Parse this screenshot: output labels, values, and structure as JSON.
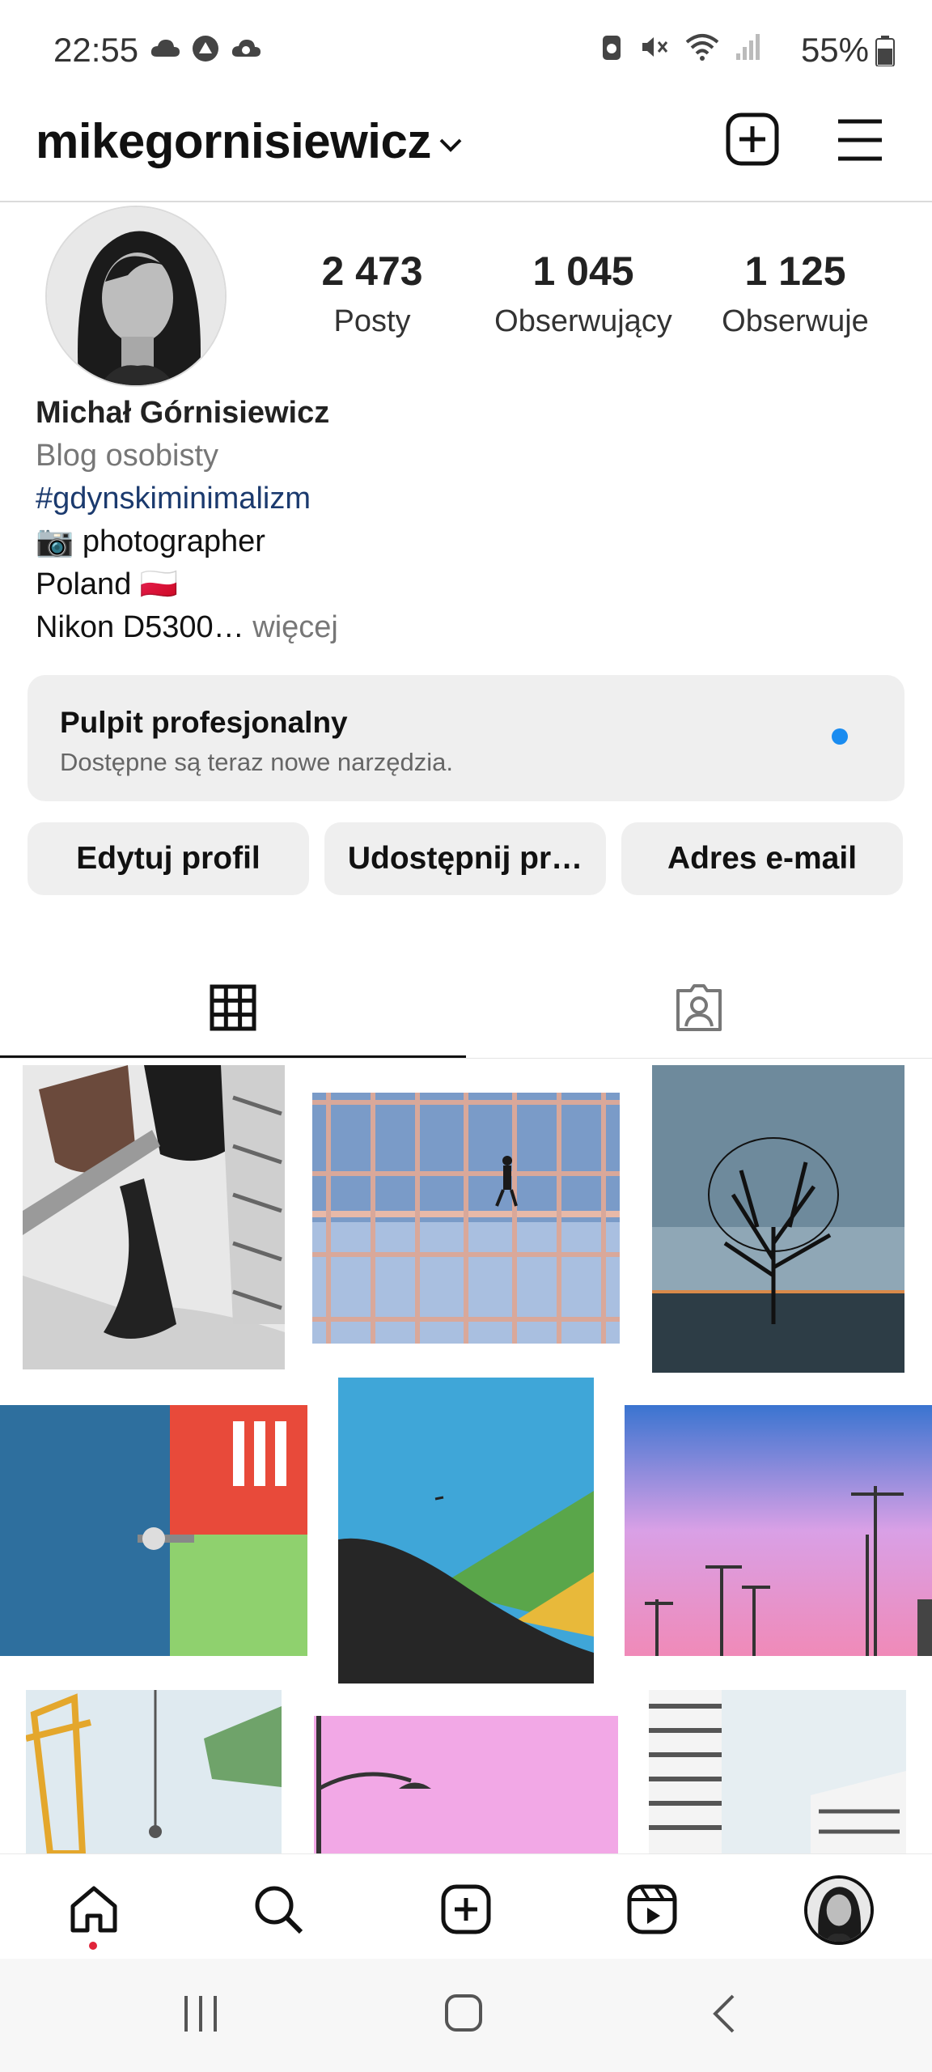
{
  "status_bar": {
    "time": "22:55",
    "battery": "55%",
    "icons_left": [
      "cloud-icon",
      "app-notification-icon",
      "cloud-sync-icon"
    ],
    "icons_right": [
      "alarm-icon",
      "mute-icon",
      "wifi-icon",
      "signal-icon",
      "battery-icon"
    ]
  },
  "header": {
    "username": "mikegornisiewicz"
  },
  "stats": [
    {
      "value": "2 473",
      "label": "Posty"
    },
    {
      "value": "1 045",
      "label": "Obserwujący"
    },
    {
      "value": "1 125",
      "label": "Obserwuje"
    }
  ],
  "bio": {
    "name": "Michał Górnisiewicz",
    "category": "Blog osobisty",
    "hashtag": "#gdynskiminimalizm",
    "line_photographer": "📷 photographer",
    "line_country": "Poland 🇵🇱",
    "line_camera": "Nikon D5300…",
    "more": " więcej"
  },
  "dashboard": {
    "title": "Pulpit profesjonalny",
    "subtitle": "Dostępne są teraz nowe narzędzia.",
    "dot_color": "#1a8cf0"
  },
  "buttons": {
    "edit": "Edytuj profil",
    "share": "Udostępnij pr…",
    "email": "Adres e-mail"
  },
  "tabs": [
    {
      "name": "posts-grid",
      "icon": "grid-icon",
      "active": true
    },
    {
      "name": "tagged",
      "icon": "tagged-person-icon",
      "active": false
    }
  ],
  "bottom_nav": [
    {
      "icon": "home-icon",
      "active": true
    },
    {
      "icon": "search-icon"
    },
    {
      "icon": "create-post-icon"
    },
    {
      "icon": "reels-icon"
    },
    {
      "icon": "profile-avatar"
    }
  ],
  "colors": {
    "hashtag": "#1b3a6e",
    "notification_dot": "#e0243a",
    "button_bg": "#efefef"
  }
}
